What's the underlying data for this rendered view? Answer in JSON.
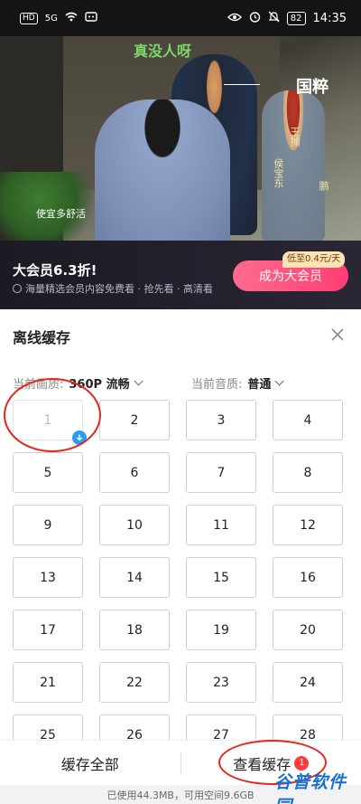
{
  "status_bar": {
    "sim": "HD",
    "network": "5G",
    "battery": "82",
    "time": "14:35"
  },
  "video": {
    "overlay_text": "真没人呀",
    "logo": "国粹",
    "cast_1": "王捕",
    "cast_2": "侯宝东",
    "cast_3": "鹏",
    "subtitle": "使宜多舒活"
  },
  "promo": {
    "title": "大会员6.3折!",
    "subtitle": "海量精选会员内容免费看 · 抢先看 · 高清看",
    "price_tag": "低至0.4元/天",
    "vip_button": "成为大会员"
  },
  "panel": {
    "title": "离线缓存",
    "video_quality_label": "当前画质:",
    "video_quality_value": "360P 流畅",
    "audio_quality_label": "当前音质:",
    "audio_quality_value": "普通",
    "episodes": [
      "1",
      "2",
      "3",
      "4",
      "5",
      "6",
      "7",
      "8",
      "9",
      "10",
      "11",
      "12",
      "13",
      "14",
      "15",
      "16",
      "17",
      "18",
      "19",
      "20",
      "21",
      "22",
      "23",
      "24",
      "25",
      "26",
      "27",
      "28"
    ],
    "downloaded_episodes": [
      "1"
    ]
  },
  "bottom_bar": {
    "cache_all": "缓存全部",
    "view_cache": "查看缓存",
    "view_cache_badge": "1"
  },
  "storage_info": "已使用44.3MB，可用空间9.6GB",
  "watermark": "谷普软件园",
  "colors": {
    "accent_blue": "#2a9df4",
    "vip_pink": "#ff3d73",
    "annotation_red": "#e5261f"
  }
}
